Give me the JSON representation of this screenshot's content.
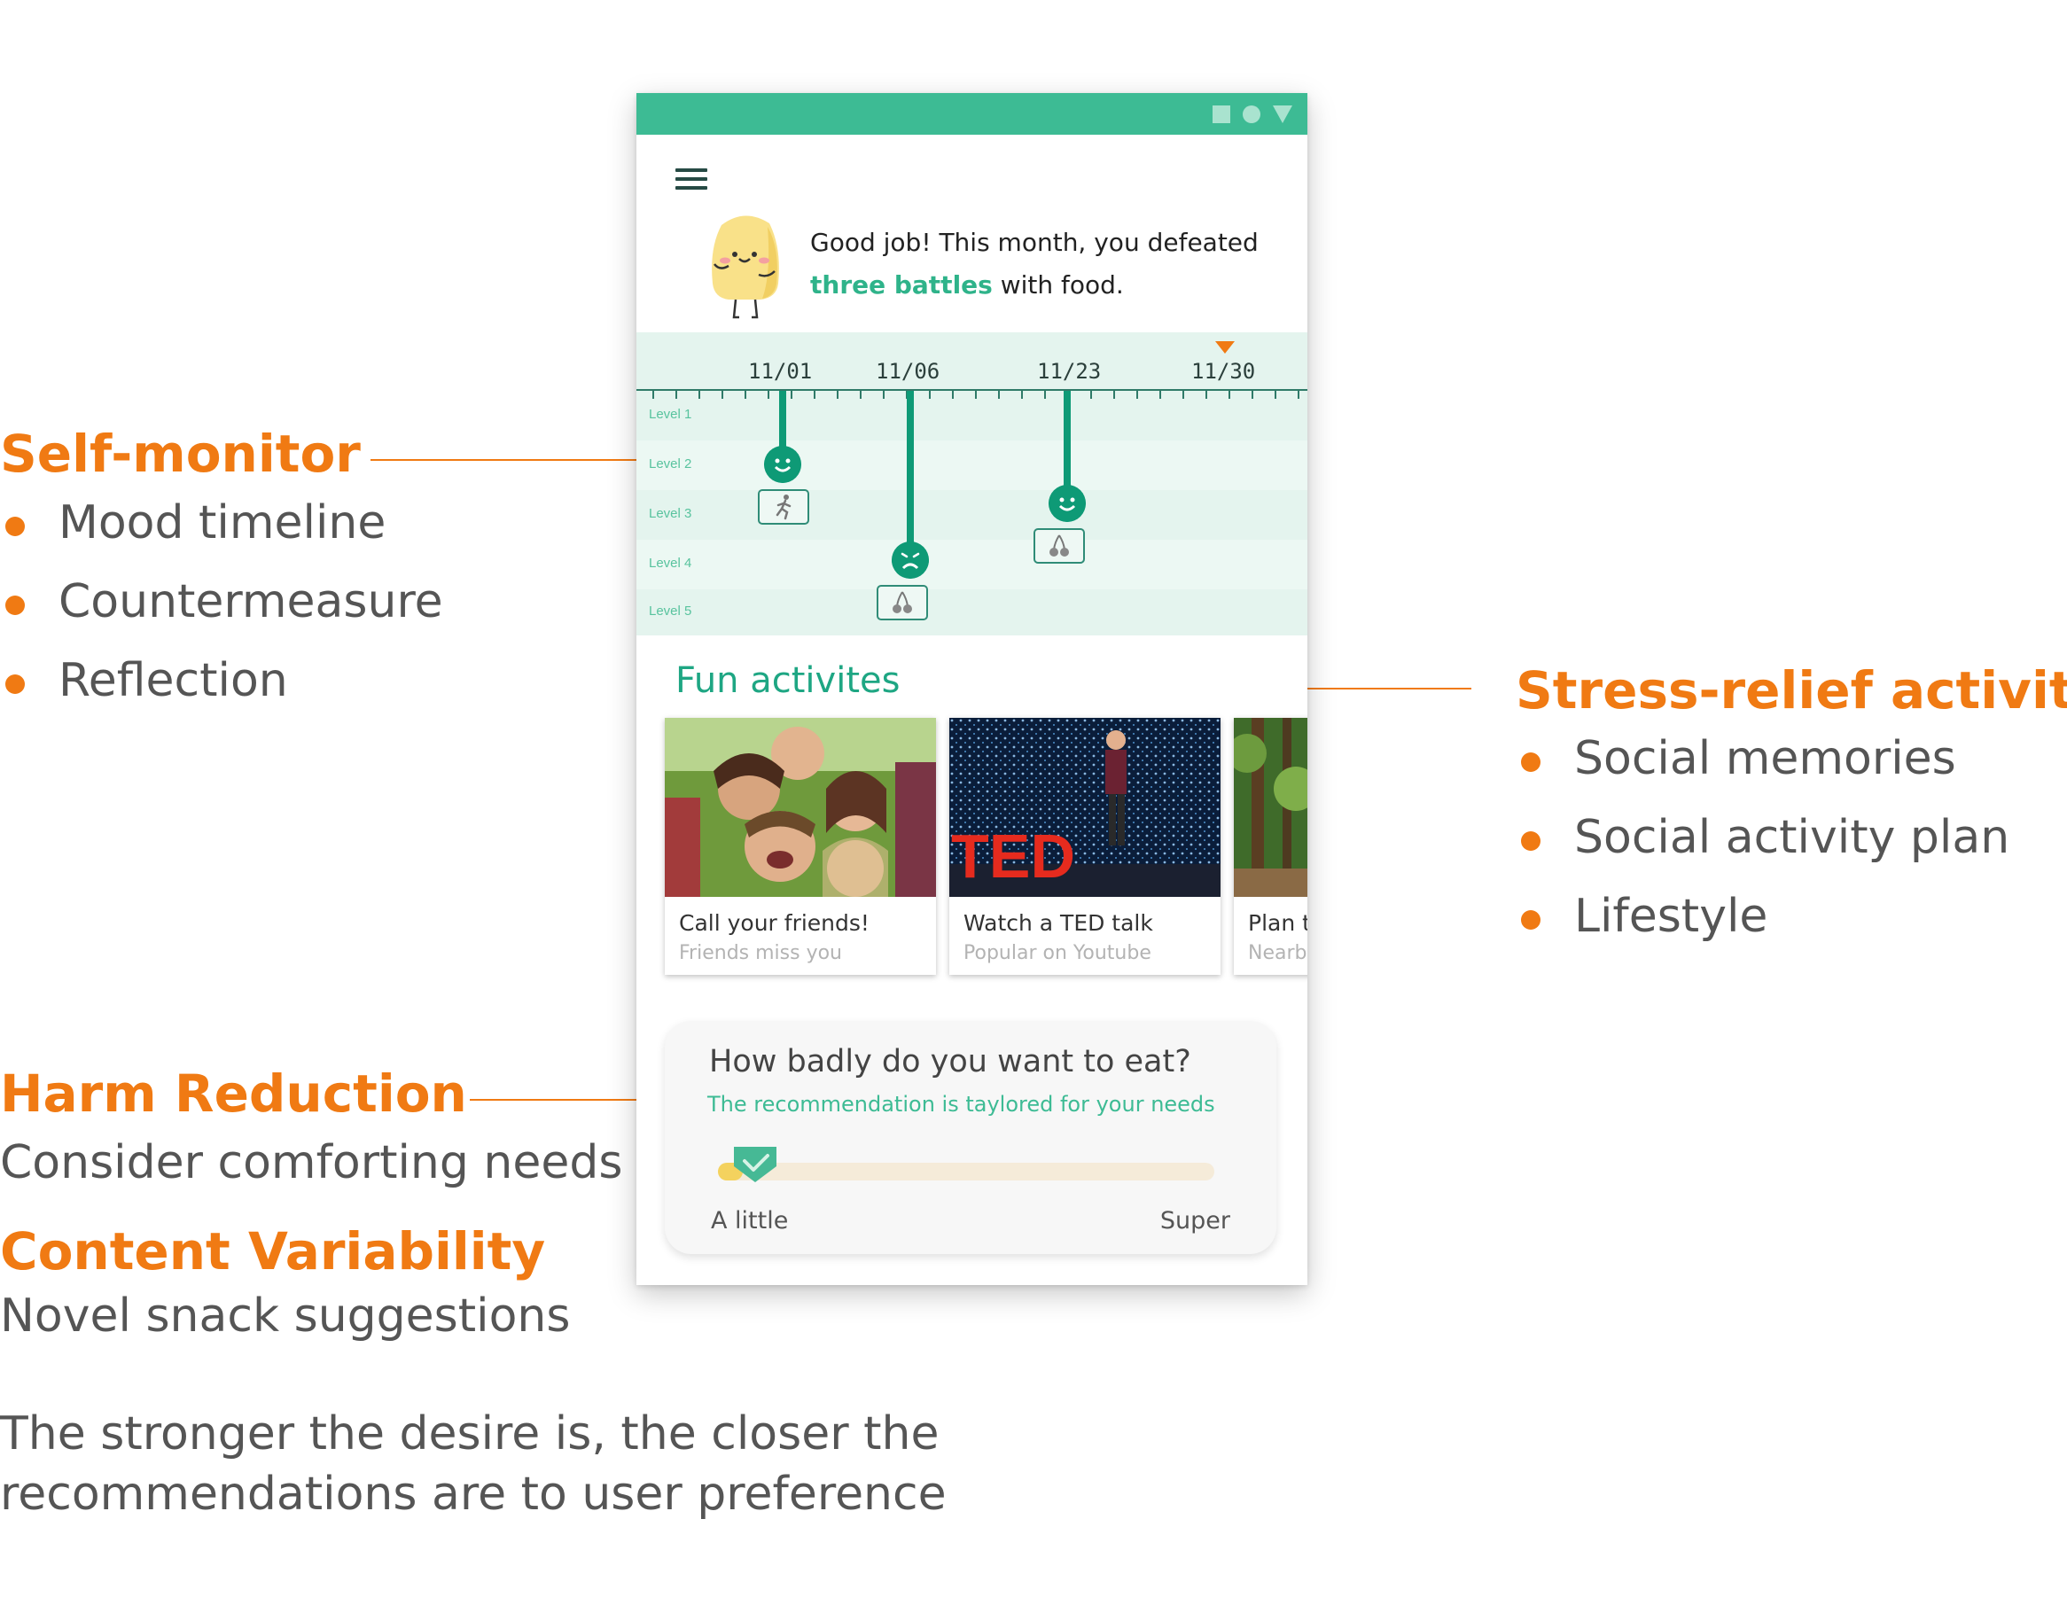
{
  "annotations": {
    "self_monitor": {
      "title": "Self-monitor",
      "items": [
        "Mood timeline",
        "Countermeasure",
        "Reflection"
      ]
    },
    "stress_relief": {
      "title": "Stress-relief activities",
      "items": [
        "Social memories",
        "Social activity plan",
        "Lifestyle"
      ]
    },
    "harm_reduction": {
      "title": "Harm Reduction",
      "text": "Consider comforting needs"
    },
    "content_variability": {
      "title": "Content Variability",
      "text": "Novel snack suggestions"
    },
    "footnote": {
      "line1": "The stronger the desire is, the closer the",
      "line2": "recommendations are to user preference"
    }
  },
  "phone": {
    "header": {
      "line1": "Good job! This month, you defeated",
      "highlight": "three battles",
      "rest": " with food."
    },
    "timeline": {
      "dates": [
        "11/01",
        "11/06",
        "11/23",
        "11/30"
      ],
      "levels": [
        "Level 1",
        "Level 2",
        "Level 3",
        "Level 4",
        "Level 5"
      ],
      "events": [
        {
          "date": "11/01",
          "level": 2,
          "mood": "happy",
          "countermeasure": "running-icon"
        },
        {
          "date": "11/06",
          "level": 4,
          "mood": "sad",
          "countermeasure": "cherry-icon"
        },
        {
          "date": "11/23",
          "level": 3,
          "mood": "happy",
          "countermeasure": "cherry-icon"
        }
      ],
      "current_date": "11/30"
    },
    "fun_title": "Fun activites",
    "cards": [
      {
        "title": "Call your friends!",
        "subtitle": "Friends miss you"
      },
      {
        "title": "Watch a TED talk",
        "subtitle": "Popular on Youtube"
      },
      {
        "title": "Plan t",
        "subtitle": "Nearb"
      }
    ],
    "question": {
      "title": "How badly do you want to eat?",
      "subtitle": "The recommendation is taylored for your needs",
      "min_label": "A little",
      "max_label": "Super",
      "value_fraction": 0.05
    },
    "colors": {
      "primary": "#3dbb94",
      "accent": "#f07a13",
      "dark_green": "#0e9a76"
    }
  }
}
